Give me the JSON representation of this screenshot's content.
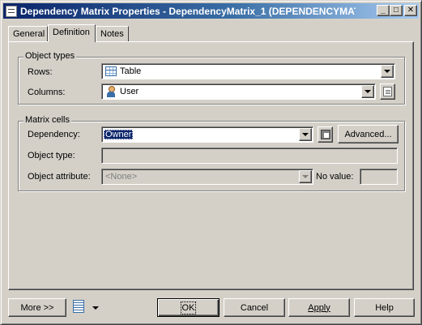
{
  "window": {
    "title": "Dependency Matrix Properties - DependencyMatrix_1 (DEPENDENCYMATRIX...",
    "buttons": {
      "minimize": "_",
      "maximize": "□",
      "close": "✕"
    }
  },
  "tabs": [
    {
      "label": "General",
      "active": false
    },
    {
      "label": "Definition",
      "active": true
    },
    {
      "label": "Notes",
      "active": false
    }
  ],
  "object_types": {
    "legend": "Object types",
    "rows_label": "Rows:",
    "rows_value": "Table",
    "rows_icon": "table-icon",
    "columns_label": "Columns:",
    "columns_value": "User",
    "columns_icon": "user-icon"
  },
  "matrix_cells": {
    "legend": "Matrix cells",
    "dependency_label": "Dependency:",
    "dependency_value": "Owner",
    "advanced_label": "Advanced...",
    "object_type_label": "Object type:",
    "object_type_value": "",
    "object_attribute_label": "Object attribute:",
    "object_attribute_value": "<None>",
    "no_value_label": "No value:",
    "no_value_value": ""
  },
  "footer": {
    "more_label": "More >>",
    "ok_label": "OK",
    "cancel_label": "Cancel",
    "apply_label": "Apply",
    "help_label": "Help"
  }
}
